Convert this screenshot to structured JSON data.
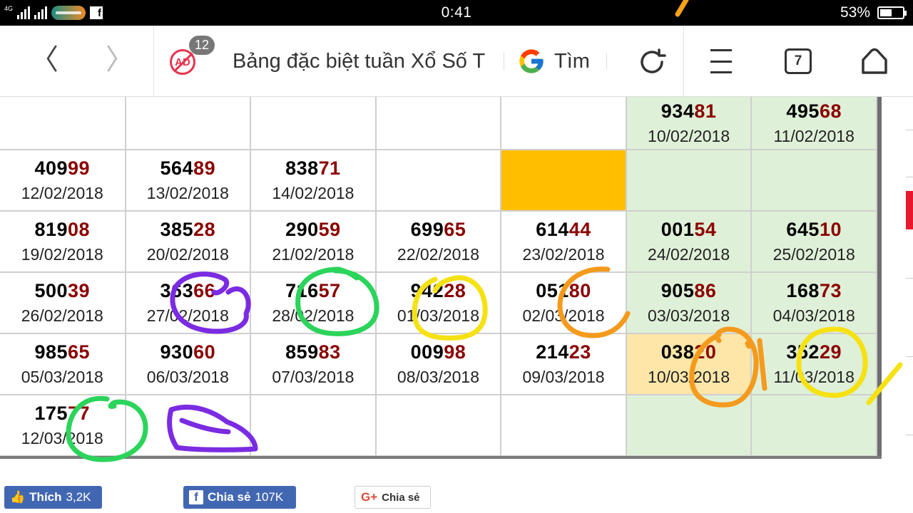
{
  "status_bar": {
    "network": "4G",
    "time": "0:41",
    "battery_percent": "53%",
    "battery_level": 0.53
  },
  "browser": {
    "back_symbol": "〈",
    "forward_symbol": "〉",
    "ad_icon_text": "AD",
    "ad_count": "12",
    "page_title": "Bảng đặc biệt tuần Xổ Số T",
    "search_label": "Tìm",
    "tab_count": "7"
  },
  "table": {
    "rows": [
      [
        {
          "prefix": "",
          "tail": "",
          "date": "",
          "style": ""
        },
        {
          "prefix": "",
          "tail": "",
          "date": "",
          "style": ""
        },
        {
          "prefix": "",
          "tail": "",
          "date": "",
          "style": ""
        },
        {
          "prefix": "",
          "tail": "",
          "date": "",
          "style": ""
        },
        {
          "prefix": "",
          "tail": "",
          "date": "",
          "style": ""
        },
        {
          "prefix": "934",
          "tail": "81",
          "date": "10/02/2018",
          "style": "weekend"
        },
        {
          "prefix": "495",
          "tail": "68",
          "date": "11/02/2018",
          "style": "weekend"
        }
      ],
      [
        {
          "prefix": "409",
          "tail": "99",
          "date": "12/02/2018",
          "style": ""
        },
        {
          "prefix": "564",
          "tail": "89",
          "date": "13/02/2018",
          "style": ""
        },
        {
          "prefix": "838",
          "tail": "71",
          "date": "14/02/2018",
          "style": ""
        },
        {
          "prefix": "",
          "tail": "",
          "date": "",
          "style": ""
        },
        {
          "prefix": "",
          "tail": "",
          "date": "",
          "style": "hl-orange"
        },
        {
          "prefix": "",
          "tail": "",
          "date": "",
          "style": "weekend"
        },
        {
          "prefix": "",
          "tail": "",
          "date": "",
          "style": "weekend"
        }
      ],
      [
        {
          "prefix": "819",
          "tail": "08",
          "date": "19/02/2018",
          "style": ""
        },
        {
          "prefix": "385",
          "tail": "28",
          "date": "20/02/2018",
          "style": ""
        },
        {
          "prefix": "290",
          "tail": "59",
          "date": "21/02/2018",
          "style": ""
        },
        {
          "prefix": "699",
          "tail": "65",
          "date": "22/02/2018",
          "style": ""
        },
        {
          "prefix": "614",
          "tail": "44",
          "date": "23/02/2018",
          "style": ""
        },
        {
          "prefix": "001",
          "tail": "54",
          "date": "24/02/2018",
          "style": "weekend"
        },
        {
          "prefix": "645",
          "tail": "10",
          "date": "25/02/2018",
          "style": "weekend"
        }
      ],
      [
        {
          "prefix": "500",
          "tail": "39",
          "date": "26/02/2018",
          "style": ""
        },
        {
          "prefix": "363",
          "tail": "66",
          "date": "27/02/2018",
          "style": ""
        },
        {
          "prefix": "716",
          "tail": "57",
          "date": "28/02/2018",
          "style": ""
        },
        {
          "prefix": "942",
          "tail": "28",
          "date": "01/03/2018",
          "style": ""
        },
        {
          "prefix": "051",
          "tail": "80",
          "date": "02/03/2018",
          "style": ""
        },
        {
          "prefix": "905",
          "tail": "86",
          "date": "03/03/2018",
          "style": "weekend"
        },
        {
          "prefix": "168",
          "tail": "73",
          "date": "04/03/2018",
          "style": "weekend"
        }
      ],
      [
        {
          "prefix": "985",
          "tail": "65",
          "date": "05/03/2018",
          "style": ""
        },
        {
          "prefix": "930",
          "tail": "60",
          "date": "06/03/2018",
          "style": ""
        },
        {
          "prefix": "859",
          "tail": "83",
          "date": "07/03/2018",
          "style": ""
        },
        {
          "prefix": "009",
          "tail": "98",
          "date": "08/03/2018",
          "style": ""
        },
        {
          "prefix": "214",
          "tail": "23",
          "date": "09/03/2018",
          "style": ""
        },
        {
          "prefix": "038",
          "tail": "20",
          "date": "10/03/2018",
          "style": "hl-light"
        },
        {
          "prefix": "352",
          "tail": "29",
          "date": "11/03/2018",
          "style": "weekend"
        }
      ],
      [
        {
          "prefix": "175",
          "tail": "77",
          "date": "12/03/2018",
          "style": ""
        },
        {
          "prefix": "",
          "tail": "",
          "date": "",
          "style": ""
        },
        {
          "prefix": "",
          "tail": "",
          "date": "",
          "style": ""
        },
        {
          "prefix": "",
          "tail": "",
          "date": "",
          "style": ""
        },
        {
          "prefix": "",
          "tail": "",
          "date": "",
          "style": ""
        },
        {
          "prefix": "",
          "tail": "",
          "date": "",
          "style": "weekend"
        },
        {
          "prefix": "",
          "tail": "",
          "date": "",
          "style": "weekend"
        }
      ]
    ]
  },
  "social": {
    "like_label": "Thích",
    "like_count": "3,2K",
    "share_label": "Chia sẻ",
    "share_count": "107K",
    "gplus_mark": "G+",
    "gplus_label": "Chia sẻ"
  },
  "colors": {
    "tail_digits": "#8b0000",
    "weekend_bg": "#dff0d8",
    "highlight_orange": "#ffbf00",
    "highlight_light": "#fde6a8",
    "facebook_blue": "#4267b2"
  }
}
